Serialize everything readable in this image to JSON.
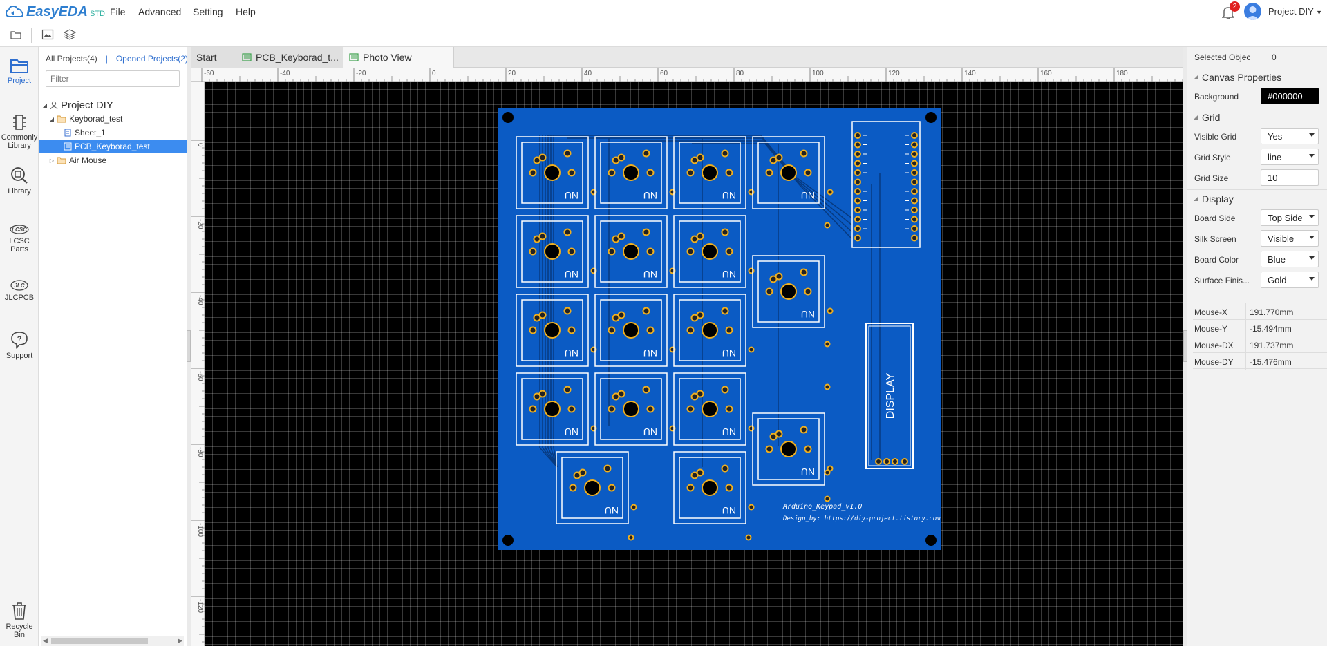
{
  "app": {
    "brand": "EasyEDA",
    "edition": "STD"
  },
  "menu": [
    "File",
    "Advanced",
    "Setting",
    "Help"
  ],
  "user": {
    "notifications": "2",
    "name": "Project DIY"
  },
  "rail": [
    {
      "label": "Project",
      "icon": "project-icon"
    },
    {
      "label": "Commonly Library",
      "icon": "commonly-library-icon"
    },
    {
      "label": "Library",
      "icon": "library-icon"
    },
    {
      "label": "LCSC Parts",
      "icon": "lcsc-icon"
    },
    {
      "label": "JLCPCB",
      "icon": "jlcpcb-icon"
    },
    {
      "label": "Support",
      "icon": "support-icon"
    },
    {
      "label": "Recycle Bin",
      "icon": "recycle-bin-icon"
    }
  ],
  "panel": {
    "all_projects": "All Projects(4)",
    "separator": "|",
    "opened_projects": "Opened Projects(2)",
    "filter_placeholder": "Filter",
    "tree": [
      {
        "label": "Project DIY",
        "level": 0,
        "kind": "user"
      },
      {
        "label": "Keyborad_test",
        "level": 1,
        "kind": "folder"
      },
      {
        "label": "Sheet_1",
        "level": 2,
        "kind": "schematic"
      },
      {
        "label": "PCB_Keyborad_test",
        "level": 2,
        "kind": "pcb",
        "selected": true
      },
      {
        "label": "Air Mouse",
        "level": 1,
        "kind": "folder"
      }
    ]
  },
  "doc_tabs": [
    {
      "label": "Start",
      "icon": ""
    },
    {
      "label": "PCB_Keyborad_t...",
      "icon": "pcb-doc-icon"
    },
    {
      "label": "Photo View",
      "icon": "photo-view-icon",
      "active": true
    }
  ],
  "rulers": {
    "top": [
      "-60",
      "-40",
      "-20",
      "0",
      "20",
      "40",
      "60",
      "80",
      "100",
      "120",
      "140",
      "160",
      "180"
    ],
    "left": [
      "0",
      "-20",
      "-40",
      "-60",
      "-80",
      "-100",
      "-120"
    ]
  },
  "board": {
    "color": "#0b5bc4",
    "silk": "#ffffff",
    "pad": "#f0b020",
    "display_label": "DISPLAY",
    "title_text": "Arduino_Keypad_v1.0",
    "design_text": "Design_by: https://diy-project.tistory.com",
    "key_label": "NU"
  },
  "properties": {
    "selected_objects_label": "Selected Objects",
    "selected_objects_value": "0",
    "canvas_section": "Canvas Properties",
    "background_label": "Background",
    "background_value": "#000000",
    "grid_section": "Grid",
    "visible_grid_label": "Visible Grid",
    "visible_grid_value": "Yes",
    "grid_style_label": "Grid Style",
    "grid_style_value": "line",
    "grid_size_label": "Grid Size",
    "grid_size_value": "10",
    "display_section": "Display",
    "board_side_label": "Board Side",
    "board_side_value": "Top Side",
    "silk_screen_label": "Silk Screen",
    "silk_screen_value": "Visible",
    "board_color_label": "Board Color",
    "board_color_value": "Blue",
    "surface_finish_label": "Surface Finis...",
    "surface_finish_value": "Gold",
    "mouse": [
      {
        "k": "Mouse-X",
        "v": "191.770mm"
      },
      {
        "k": "Mouse-Y",
        "v": "-15.494mm"
      },
      {
        "k": "Mouse-DX",
        "v": "191.737mm"
      },
      {
        "k": "Mouse-DY",
        "v": "-15.476mm"
      }
    ]
  }
}
